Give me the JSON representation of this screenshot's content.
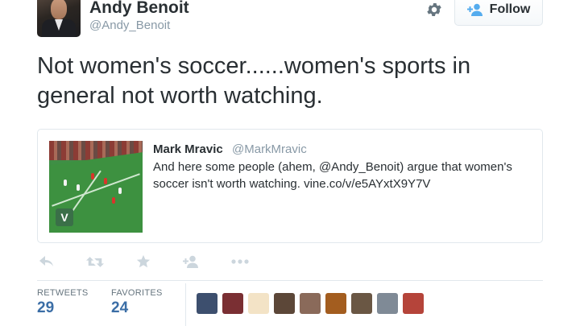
{
  "user": {
    "fullname": "Andy Benoit",
    "username": "@Andy_Benoit"
  },
  "header": {
    "follow_label": "Follow",
    "settings_icon": "gear-icon",
    "follow_icon": "add-user-icon"
  },
  "tweet": {
    "text": "Not women's soccer......women's sports in general not worth watching."
  },
  "quote": {
    "name": "Mark Mravic",
    "handle": "@MarkMravic",
    "text": "And here some people (ahem, @Andy_Benoit) argue that women's soccer isn't worth watching. vine.co/v/e5AYxtX9Y7V",
    "media_badge": "V"
  },
  "actions": [
    "reply-icon",
    "retweet-icon",
    "favorite-icon",
    "follow-icon",
    "more-icon"
  ],
  "stats": {
    "retweets_label": "RETWEETS",
    "retweets_value": "29",
    "favorites_label": "FAVORITES",
    "favorites_value": "24"
  },
  "favoriters": [
    {
      "name": "favoriter-avatar",
      "color": "#3d4f6e"
    },
    {
      "name": "favoriter-avatar",
      "color": "#7a2f33"
    },
    {
      "name": "favoriter-avatar",
      "color": "#f3e3c6"
    },
    {
      "name": "favoriter-avatar",
      "color": "#5c4738"
    },
    {
      "name": "favoriter-avatar",
      "color": "#8a6a5a"
    },
    {
      "name": "favoriter-avatar",
      "color": "#a35d1f"
    },
    {
      "name": "favoriter-avatar",
      "color": "#6a5744"
    },
    {
      "name": "favoriter-avatar",
      "color": "#7f8a96"
    },
    {
      "name": "favoriter-avatar",
      "color": "#b5443a"
    }
  ],
  "colors": {
    "link_blue": "#3b6ea6",
    "muted": "#8899a6",
    "text": "#292f33"
  }
}
